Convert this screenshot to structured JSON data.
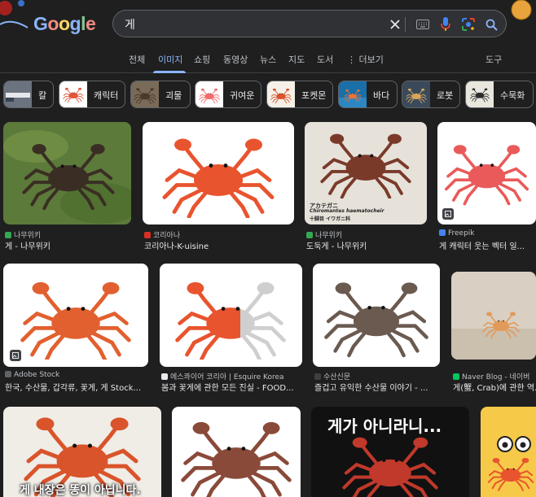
{
  "logo": "Google",
  "search": {
    "query": "게"
  },
  "tabs": [
    {
      "label": "전체"
    },
    {
      "label": "이미지"
    },
    {
      "label": "쇼핑"
    },
    {
      "label": "동영상"
    },
    {
      "label": "뉴스"
    },
    {
      "label": "지도"
    },
    {
      "label": "도서"
    },
    {
      "label": "더보기"
    }
  ],
  "tools_label": "도구",
  "chips": [
    {
      "label": "칼"
    },
    {
      "label": "캐릭터"
    },
    {
      "label": "괴물"
    },
    {
      "label": "귀여운"
    },
    {
      "label": "포켓몬"
    },
    {
      "label": "바다"
    },
    {
      "label": "로봇"
    },
    {
      "label": "수묵화"
    }
  ],
  "results": [
    {
      "source": "나무위키",
      "title": "게 - 나무위키"
    },
    {
      "source": "코리아나",
      "title": "코리아나-K-uisine"
    },
    {
      "source": "나무위키",
      "title": "도둑게 - 나무위키",
      "image_caption": "アカテガニ",
      "image_caption_latin": "Chiromantes haematocheir",
      "image_caption_sub": "十脚目 イワガニ科"
    },
    {
      "source": "Freepik",
      "title": "게 캐릭터 웃는 벡터 일..."
    },
    {
      "source": "Adobe Stock",
      "title": "한국, 수산물, 갑각류, 꽃게, 게 Stock..."
    },
    {
      "source": "에스콰이어 코리아 | Esquire Korea",
      "title": "봄과 꽃게에 관한 모든 진실 - FOOD..."
    },
    {
      "source": "수산신문",
      "title": "즐겁고 유익한 수산물 이야기 - ..."
    },
    {
      "source": "Naver Blog - 네이버",
      "title": "게(蟹, Crab)에 관한 역..."
    },
    {
      "image_caption": "게 내장은 똥이 아닙니다."
    },
    {},
    {
      "image_caption": "게가 아니라니..."
    },
    {}
  ],
  "colors": {
    "background": "#1f1f1f",
    "accent": "#8ab4f8",
    "text": "#e8eaed",
    "muted": "#bdc1c6"
  }
}
